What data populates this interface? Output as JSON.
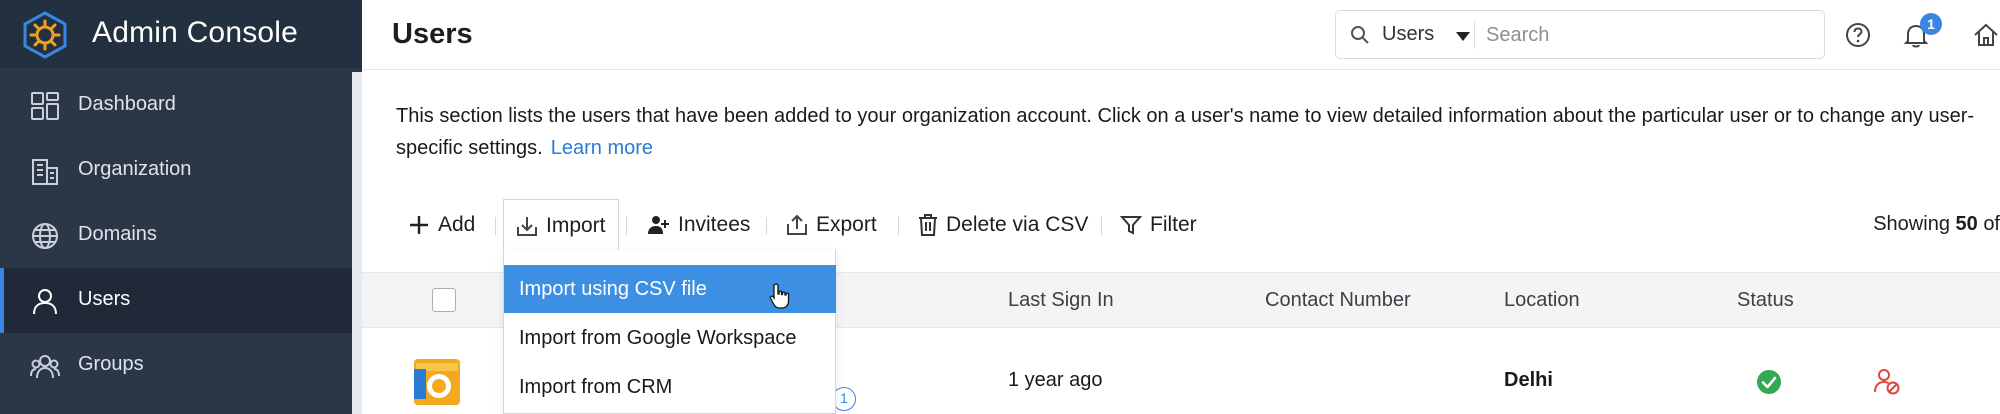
{
  "app": {
    "title": "Admin Console",
    "accent_color": "#3a86e0",
    "sidebar_color": "#2b3647"
  },
  "sidebar": {
    "items": [
      {
        "label": "Dashboard",
        "icon": "dashboard-icon"
      },
      {
        "label": "Organization",
        "icon": "building-icon"
      },
      {
        "label": "Domains",
        "icon": "globe-icon"
      },
      {
        "label": "Users",
        "icon": "user-icon",
        "active": true
      },
      {
        "label": "Groups",
        "icon": "group-icon"
      }
    ]
  },
  "header": {
    "page_title": "Users",
    "search": {
      "scope": "Users",
      "placeholder": "Search"
    },
    "notifications_count": "1"
  },
  "description": {
    "text": "This section lists the users that have been added to your organization account. Click on a user's name to view detailed information about the particular user or to change any user-specific settings.",
    "learn_more": "Learn more"
  },
  "toolbar": {
    "add": "Add",
    "import": "Import",
    "invitees": "Invitees",
    "export": "Export",
    "delete_csv": "Delete via CSV",
    "filter": "Filter",
    "showing_prefix": "Showing",
    "showing_count": "50",
    "showing_suffix": "of"
  },
  "import_menu": {
    "items": [
      {
        "label": "Import using CSV file",
        "highlighted": true
      },
      {
        "label": "Import from Google Workspace"
      },
      {
        "label": "Import from CRM"
      }
    ]
  },
  "table": {
    "columns": [
      "Last Sign In",
      "Contact Number",
      "Location",
      "Status"
    ],
    "rows": [
      {
        "last_sign_in": "1 year ago",
        "contact_number": "",
        "location": "Delhi",
        "status": "active",
        "badge_count": "1"
      }
    ],
    "status_color": "#34a853",
    "remove_color": "#e0463a"
  }
}
